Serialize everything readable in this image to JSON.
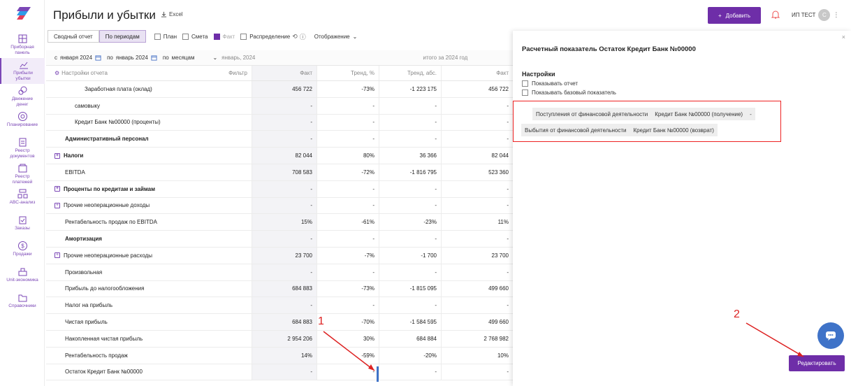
{
  "colors": {
    "accent": "#6e2ea8",
    "annotation": "#dd2222",
    "chat": "#3f73c8"
  },
  "header": {
    "title": "Прибыли и убытки",
    "excel_label": "Excel",
    "add_label": "Добавить",
    "user_name": "ИП ТЕСТ",
    "avatar_letter": "С"
  },
  "sidebar": {
    "items": [
      {
        "label": "Приборная\nпанель",
        "icon": "dashboard-icon"
      },
      {
        "label": "Прибыли\nубытки",
        "icon": "chart-icon"
      },
      {
        "label": "Движение\nденег",
        "icon": "coins-icon"
      },
      {
        "label": "Планирование",
        "icon": "target-icon"
      },
      {
        "label": "Реестр\nдокументов",
        "icon": "documents-icon"
      },
      {
        "label": "Реестр\nплатежей",
        "icon": "payments-icon"
      },
      {
        "label": "ABC-анализ",
        "icon": "abc-icon"
      },
      {
        "label": "Заказы",
        "icon": "orders-icon"
      },
      {
        "label": "Продажи",
        "icon": "dollar-icon"
      },
      {
        "label": "Unit-экономика",
        "icon": "unit-icon"
      },
      {
        "label": "Справочники",
        "icon": "folder-icon"
      }
    ]
  },
  "toolbar": {
    "tab_summary": "Сводный отчет",
    "tab_periods": "По периодам",
    "chk_plan": "План",
    "chk_estimate": "Смета",
    "chk_fact": "Факт",
    "chk_distribution": "Распределение",
    "display": "Отображение"
  },
  "filters": {
    "from_prefix": "с",
    "from_value": "января 2024",
    "to_prefix": "по",
    "to_value": "январь 2024",
    "by_prefix": "по",
    "by_value": "месяцам",
    "period_col": "январь, 2024",
    "total_col": "итого за 2024 год"
  },
  "table": {
    "settings_label": "Настройки отчета",
    "filter_label": "Фильтр",
    "columns": [
      "Факт",
      "Тренд, %",
      "Тренд, абс.",
      "Факт"
    ],
    "rows": [
      {
        "name": "Заработная плата (оклад)",
        "indent": 3,
        "bold": false,
        "plus": false,
        "v": [
          "456 722",
          "-73%",
          "-1 223 175",
          "456 722"
        ]
      },
      {
        "name": "самовыку",
        "indent": 2,
        "bold": false,
        "plus": false,
        "v": [
          "-",
          "-",
          "-",
          "-"
        ]
      },
      {
        "name": "Кредит Банк №00000 (проценты)",
        "indent": 2,
        "bold": false,
        "plus": false,
        "v": [
          "-",
          "-",
          "-",
          "-"
        ]
      },
      {
        "name": "Административный персонал",
        "indent": 1,
        "bold": true,
        "plus": false,
        "v": [
          "-",
          "-",
          "-",
          "-"
        ]
      },
      {
        "name": "Налоги",
        "indent": 0,
        "bold": true,
        "plus": true,
        "v": [
          "82 044",
          "80%",
          "36 366",
          "82 044"
        ]
      },
      {
        "name": "EBITDA",
        "indent": 1,
        "bold": false,
        "plus": false,
        "v": [
          "708 583",
          "-72%",
          "-1 816 795",
          "523 360"
        ]
      },
      {
        "name": "Проценты по кредитам и займам",
        "indent": 0,
        "bold": true,
        "plus": true,
        "v": [
          "-",
          "-",
          "-",
          "-"
        ]
      },
      {
        "name": "Прочие неоперационные доходы",
        "indent": 0,
        "bold": false,
        "plus": true,
        "v": [
          "-",
          "-",
          "-",
          "-"
        ]
      },
      {
        "name": "Рентабельность продаж по EBITDA",
        "indent": 1,
        "bold": false,
        "plus": false,
        "v": [
          "15%",
          "-61%",
          "-23%",
          "11%"
        ]
      },
      {
        "name": "Амортизация",
        "indent": 1,
        "bold": true,
        "plus": false,
        "v": [
          "-",
          "-",
          "-",
          "-"
        ]
      },
      {
        "name": "Прочие неоперационные расходы",
        "indent": 0,
        "bold": false,
        "plus": true,
        "v": [
          "23 700",
          "-7%",
          "-1 700",
          "23 700"
        ]
      },
      {
        "name": "Произвольная",
        "indent": 1,
        "bold": false,
        "plus": false,
        "v": [
          "-",
          "-",
          "-",
          "-"
        ]
      },
      {
        "name": "Прибыль до налогообложения",
        "indent": 1,
        "bold": false,
        "plus": false,
        "v": [
          "684 883",
          "-73%",
          "-1 815 095",
          "499 660"
        ]
      },
      {
        "name": "Налог на прибыль",
        "indent": 1,
        "bold": false,
        "plus": false,
        "v": [
          "-",
          "-",
          "-",
          "-"
        ]
      },
      {
        "name": "Чистая прибыль",
        "indent": 1,
        "bold": false,
        "plus": false,
        "v": [
          "684 883",
          "-70%",
          "-1 584 595",
          "499 660"
        ]
      },
      {
        "name": "Накопленная чистая прибыль",
        "indent": 1,
        "bold": false,
        "plus": false,
        "v": [
          "2 954 206",
          "30%",
          "684 884",
          "2 768 982"
        ]
      },
      {
        "name": "Рентабельность продаж",
        "indent": 1,
        "bold": false,
        "plus": false,
        "v": [
          "14%",
          "-59%",
          "-20%",
          "10%"
        ]
      },
      {
        "name": "Остаток Кредит Банк №00000",
        "indent": 1,
        "bold": false,
        "plus": false,
        "v": [
          "-",
          "-",
          "-",
          "-"
        ]
      }
    ]
  },
  "panel": {
    "title": "Расчетный показатель Остаток Кредит Банк №00000",
    "settings": "Настройки",
    "show_report": "Показывать отчет",
    "show_base": "Показывать базовый показатель",
    "tag1_left": "Поступления от финансовой деятельности",
    "tag1_right": "Кредит Банк №00000 (получение)",
    "tag1_op": "-",
    "tag2_left": "Выбытия от финансовой деятельности",
    "tag2_right": "Кредит Банк №00000 (возврат)",
    "edit_label": "Редактировать",
    "close": "×"
  },
  "annotations": {
    "one": "1",
    "two": "2"
  }
}
